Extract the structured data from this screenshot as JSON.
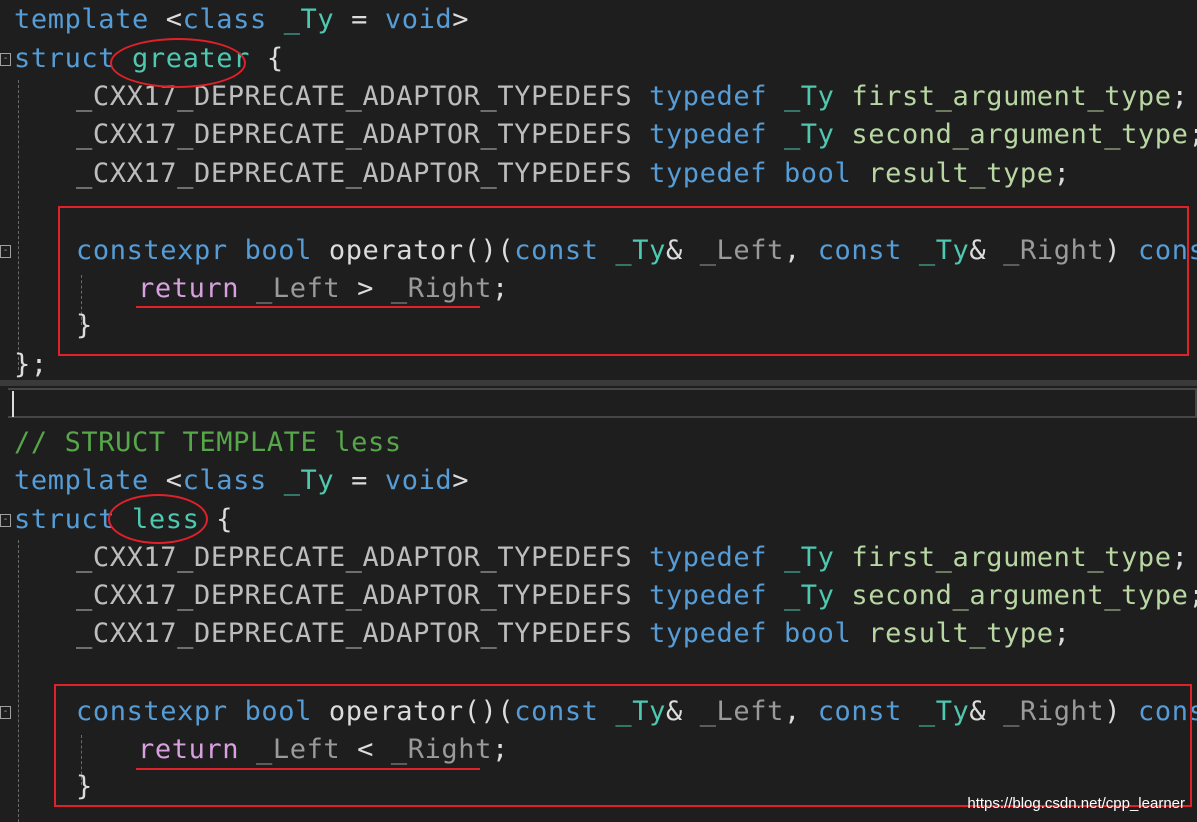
{
  "code": {
    "line1": {
      "kw1": "template",
      "p1": " <",
      "kw2": "class",
      "sp": " ",
      "ty": "_Ty",
      "eq": " = ",
      "kw3": "void",
      "p2": ">"
    },
    "line2": {
      "kw": "struct",
      "sp": " ",
      "name": "greater",
      "rest": " {"
    },
    "line3": {
      "macro": "_CXX17_DEPRECATE_ADAPTOR_TYPEDEFS",
      "sp1": " ",
      "kw": "typedef",
      "sp2": " ",
      "ty": "_Ty",
      "sp3": " ",
      "name": "first_argument_type",
      "semi": ";"
    },
    "line4": {
      "macro": "_CXX17_DEPRECATE_ADAPTOR_TYPEDEFS",
      "sp1": " ",
      "kw": "typedef",
      "sp2": " ",
      "ty": "_Ty",
      "sp3": " ",
      "name": "second_argument_type",
      "semi": ";"
    },
    "line5": {
      "macro": "_CXX17_DEPRECATE_ADAPTOR_TYPEDEFS",
      "sp1": " ",
      "kw": "typedef",
      "sp2": " ",
      "kw2": "bool",
      "sp3": " ",
      "name": "result_type",
      "semi": ";"
    },
    "line6": {
      "kw1": "constexpr",
      "sp1": " ",
      "kw2": "bool",
      "sp2": " ",
      "fn": "operator",
      "paren": "()(",
      "kw3": "const",
      "sp3": " ",
      "ty1": "_Ty",
      "amp1": "&",
      "sp4": " ",
      "p1": "_Left",
      "comma": ", ",
      "kw4": "const",
      "sp5": " ",
      "ty2": "_Ty",
      "amp2": "&",
      "sp6": " ",
      "p2": "_Right",
      "close": ")",
      "sp7": " ",
      "kw5": "const",
      "brace": " {"
    },
    "line7": {
      "ret": "return",
      "sp1": " ",
      "p1": "_Left",
      "op": " > ",
      "p2": "_Right",
      "semi": ";"
    },
    "line8": {
      "brace": "}"
    },
    "line9": {
      "end": "};"
    },
    "line10": {
      "comment": "// STRUCT TEMPLATE less"
    },
    "line11": {
      "kw1": "template",
      "p1": " <",
      "kw2": "class",
      "sp": " ",
      "ty": "_Ty",
      "eq": " = ",
      "kw3": "void",
      "p2": ">"
    },
    "line12": {
      "kw": "struct",
      "sp": " ",
      "name": "less",
      "rest": " {"
    },
    "line13": {
      "macro": "_CXX17_DEPRECATE_ADAPTOR_TYPEDEFS",
      "sp1": " ",
      "kw": "typedef",
      "sp2": " ",
      "ty": "_Ty",
      "sp3": " ",
      "name": "first_argument_type",
      "semi": ";"
    },
    "line14": {
      "macro": "_CXX17_DEPRECATE_ADAPTOR_TYPEDEFS",
      "sp1": " ",
      "kw": "typedef",
      "sp2": " ",
      "ty": "_Ty",
      "sp3": " ",
      "name": "second_argument_type",
      "semi": ";"
    },
    "line15": {
      "macro": "_CXX17_DEPRECATE_ADAPTOR_TYPEDEFS",
      "sp1": " ",
      "kw": "typedef",
      "sp2": " ",
      "kw2": "bool",
      "sp3": " ",
      "name": "result_type",
      "semi": ";"
    },
    "line16": {
      "kw1": "constexpr",
      "sp1": " ",
      "kw2": "bool",
      "sp2": " ",
      "fn": "operator",
      "paren": "()(",
      "kw3": "const",
      "sp3": " ",
      "ty1": "_Ty",
      "amp1": "&",
      "sp4": " ",
      "p1": "_Left",
      "comma": ", ",
      "kw4": "const",
      "sp5": " ",
      "ty2": "_Ty",
      "amp2": "&",
      "sp6": " ",
      "p2": "_Right",
      "close": ")",
      "sp7": " ",
      "kw5": "const",
      "brace": " {"
    },
    "line17": {
      "ret": "return",
      "sp1": " ",
      "p1": "_Left",
      "op": " < ",
      "p2": "_Right",
      "semi": ";"
    },
    "line18": {
      "brace": "}"
    }
  },
  "fold_glyph": "-",
  "watermark": "https://blog.csdn.net/cpp_learner",
  "colors": {
    "annotation": "#e0212a",
    "background": "#1e1e1e",
    "keyword": "#569cd6",
    "type": "#4ec9b0",
    "comment": "#57a64a"
  }
}
